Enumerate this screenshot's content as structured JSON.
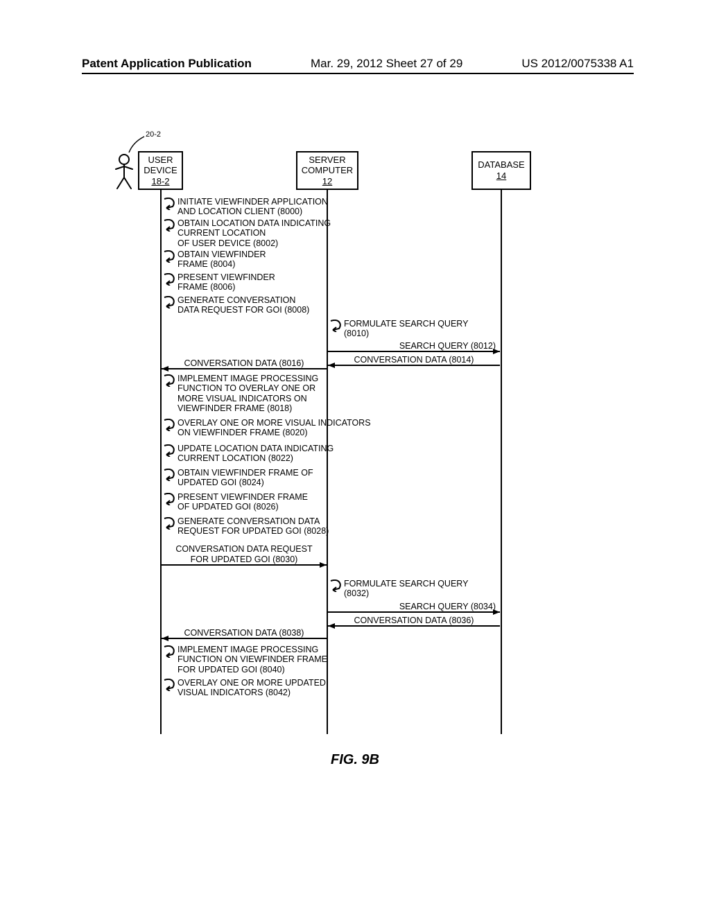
{
  "header": {
    "left": "Patent Application Publication",
    "middle": "Mar. 29, 2012  Sheet 27 of 29",
    "right": "US 2012/0075338 A1"
  },
  "callout": "20-2",
  "boxes": {
    "user_device": {
      "line1": "USER",
      "line2": "DEVICE",
      "id": "18-2"
    },
    "server": {
      "line1": "SERVER",
      "line2": "COMPUTER",
      "id": "12"
    },
    "database": {
      "line1": "DATABASE",
      "id": "14"
    }
  },
  "steps_left": [
    "INITIATE VIEWFINDER APPLICATION\nAND LOCATION CLIENT (8000)",
    "OBTAIN LOCATION DATA INDICATING\nCURRENT LOCATION\nOF USER DEVICE (8002)",
    "OBTAIN VIEWFINDER\nFRAME (8004)",
    "PRESENT VIEWFINDER\nFRAME (8006)",
    "GENERATE CONVERSATION\nDATA REQUEST FOR GOI (8008)",
    "IMPLEMENT IMAGE PROCESSING\nFUNCTION TO OVERLAY ONE OR\nMORE VISUAL INDICATORS ON\nVIEWFINDER FRAME (8018)",
    "OVERLAY ONE OR MORE VISUAL INDICATORS\nON VIEWFINDER FRAME (8020)",
    "UPDATE LOCATION DATA INDICATING\nCURRENT LOCATION (8022)",
    "OBTAIN VIEWFINDER FRAME OF\nUPDATED GOI (8024)",
    "PRESENT VIEWFINDER FRAME\nOF UPDATED GOI (8026)",
    "GENERATE CONVERSATION DATA\nREQUEST FOR UPDATED GOI (8028)",
    "IMPLEMENT IMAGE PROCESSING\nFUNCTION ON VIEWFINDER FRAME\nFOR UPDATED GOI  (8040)",
    "OVERLAY ONE OR MORE UPDATED\nVISUAL INDICATORS  (8042)"
  ],
  "steps_right": [
    "FORMULATE SEARCH QUERY\n(8010)",
    "FORMULATE SEARCH QUERY\n(8032)"
  ],
  "messages": {
    "m1": "SEARCH QUERY (8012)",
    "m2": "CONVERSATION DATA (8014)",
    "m3": "CONVERSATION DATA (8016)",
    "m4": "CONVERSATION DATA REQUEST\nFOR UPDATED GOI (8030)",
    "m5": "SEARCH QUERY (8034)",
    "m6": "CONVERSATION DATA (8036)",
    "m7": "CONVERSATION DATA (8038)"
  },
  "fig_caption": "FIG. 9B"
}
